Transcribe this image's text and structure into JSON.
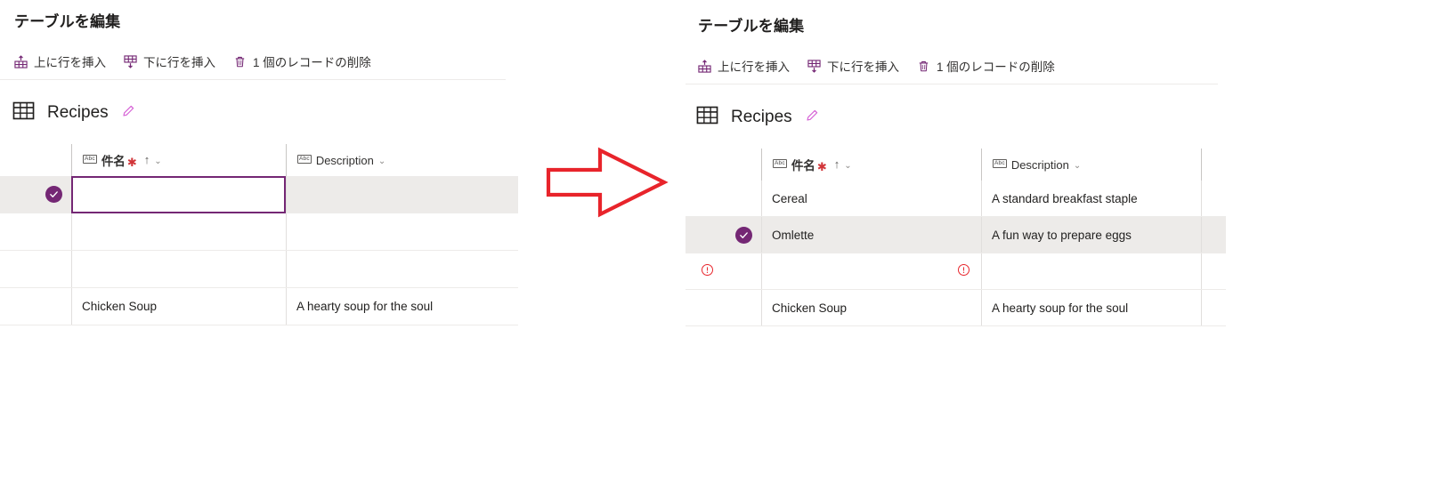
{
  "left_panel": {
    "title": "テーブルを編集",
    "toolbar": [
      {
        "label": "上に行を挿入",
        "icon": "insert-row-above-icon"
      },
      {
        "label": "下に行を挿入",
        "icon": "insert-row-below-icon"
      },
      {
        "label": "1 個のレコードの削除",
        "icon": "trash-icon"
      }
    ],
    "table_name": "Recipes",
    "edit_icon": "pencil-icon",
    "table_icon": "table-grid-icon",
    "columns": [
      {
        "label": "件名",
        "type_badge": "Abc",
        "required": true,
        "sorted": "asc",
        "menu": true
      },
      {
        "label": "Description",
        "type_badge": "Abc",
        "required": false,
        "sorted": "none",
        "menu": true
      }
    ],
    "rows": [
      {
        "selected": true,
        "editing": true,
        "subject": "",
        "description": "",
        "error_gutter": false,
        "error_subject": false
      },
      {
        "selected": false,
        "editing": false,
        "subject": "",
        "description": "",
        "error_gutter": false,
        "error_subject": false
      },
      {
        "selected": false,
        "editing": false,
        "subject": "",
        "description": "",
        "error_gutter": false,
        "error_subject": false
      },
      {
        "selected": false,
        "editing": false,
        "subject": "Chicken Soup",
        "description": "A hearty soup for the soul",
        "error_gutter": false,
        "error_subject": false
      }
    ]
  },
  "right_panel": {
    "title": "テーブルを編集",
    "toolbar": [
      {
        "label": "上に行を挿入",
        "icon": "insert-row-above-icon"
      },
      {
        "label": "下に行を挿入",
        "icon": "insert-row-below-icon"
      },
      {
        "label": "1 個のレコードの削除",
        "icon": "trash-icon"
      }
    ],
    "table_name": "Recipes",
    "edit_icon": "pencil-icon",
    "table_icon": "table-grid-icon",
    "columns": [
      {
        "label": "件名",
        "type_badge": "Abc",
        "required": true,
        "sorted": "asc",
        "menu": true
      },
      {
        "label": "Description",
        "type_badge": "Abc",
        "required": false,
        "sorted": "none",
        "menu": true
      }
    ],
    "rows": [
      {
        "selected": false,
        "editing": false,
        "subject": "Cereal",
        "description": "A standard breakfast staple",
        "error_gutter": false,
        "error_subject": false
      },
      {
        "selected": true,
        "editing": false,
        "subject": "Omlette",
        "description": "A fun way to prepare eggs",
        "error_gutter": false,
        "error_subject": false
      },
      {
        "selected": false,
        "editing": false,
        "subject": "",
        "description": "",
        "error_gutter": true,
        "error_subject": true
      },
      {
        "selected": false,
        "editing": false,
        "subject": "Chicken Soup",
        "description": "A hearty soup for the soul",
        "error_gutter": false,
        "error_subject": false
      }
    ]
  },
  "annotation": {
    "shape": "right-arrow",
    "color": "#e8242b"
  },
  "colors": {
    "accent": "#742774",
    "pencil": "#d664d6",
    "error": "#e8242b",
    "required_star": "#d13438",
    "row_selected_bg": "#edebe9",
    "grid_line": "#e1dfdd"
  }
}
